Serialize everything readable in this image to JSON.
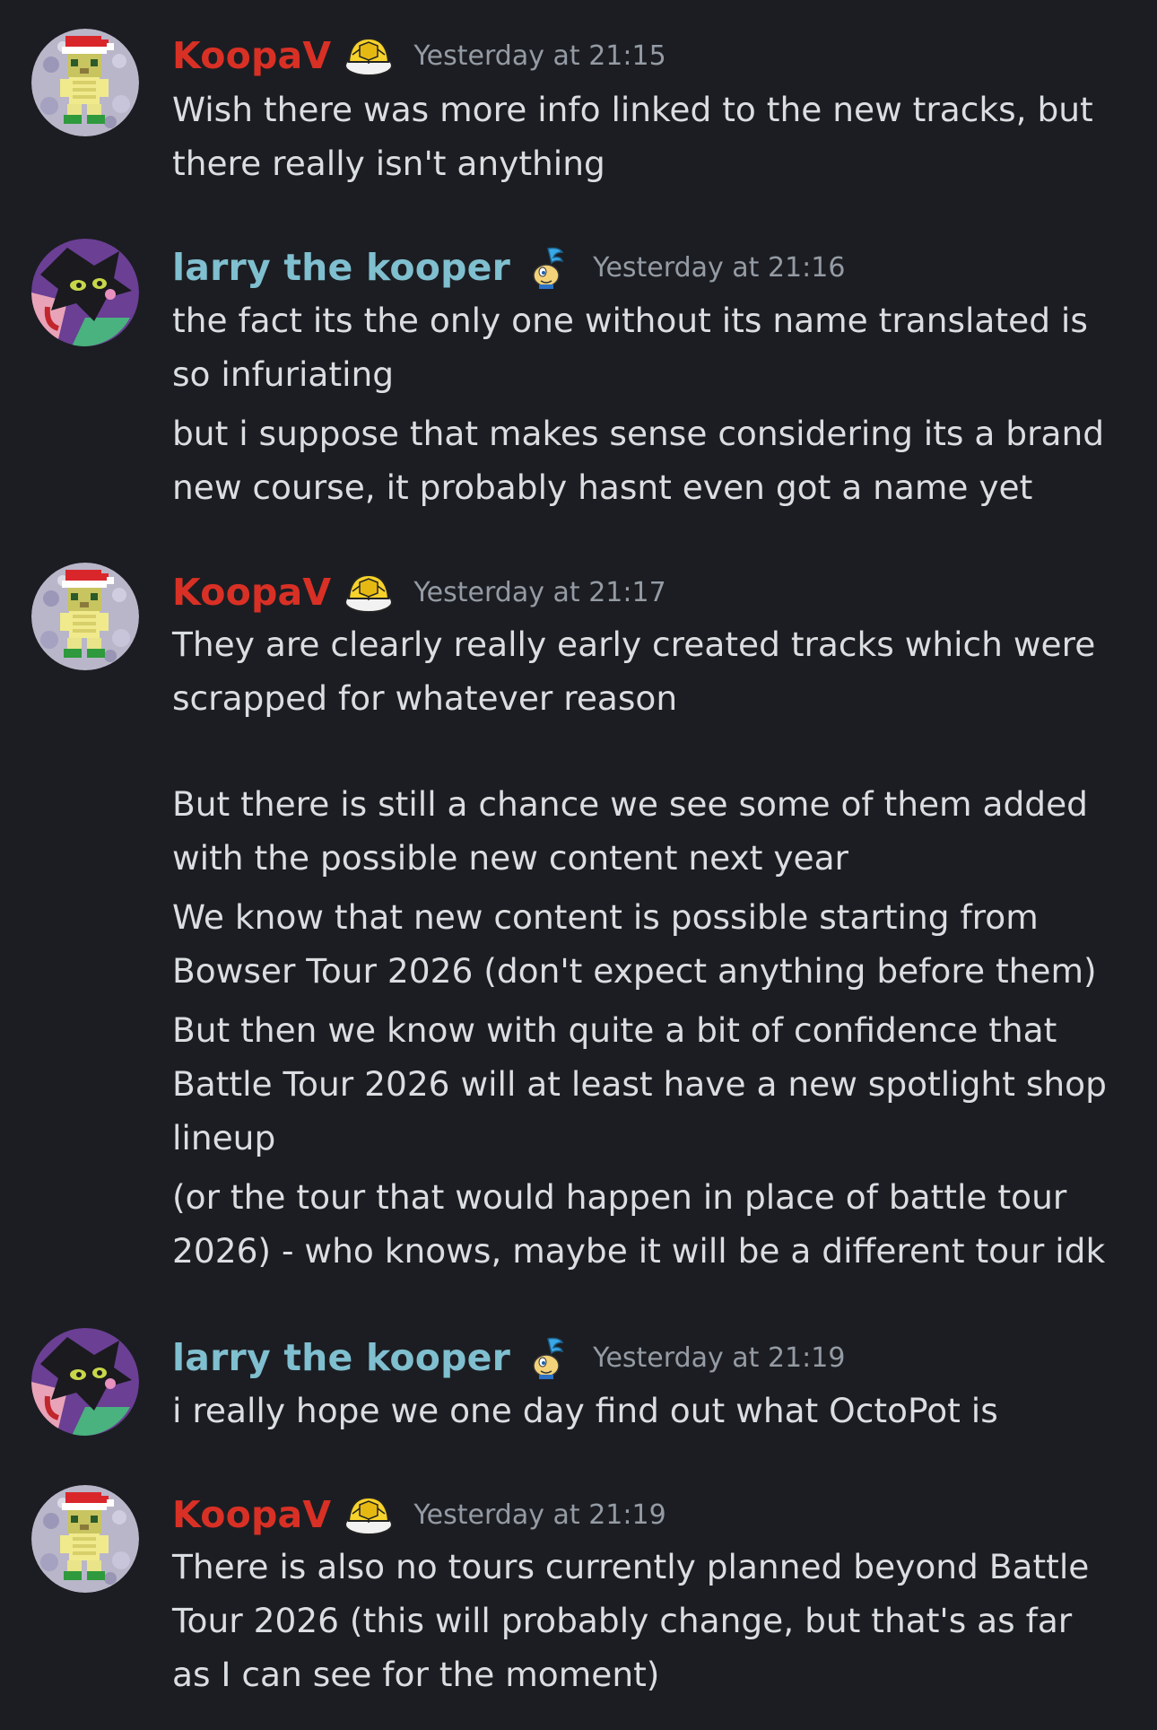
{
  "colors": {
    "background": "#1c1d22",
    "koopa_name": "#d93025",
    "larry_name": "#7fbfcf",
    "timestamp": "#949ba4",
    "text": "#dbdee1"
  },
  "messages": [
    {
      "author": "KoopaV",
      "author_color": "#d93025",
      "avatar_icon": "pixel-koopa-santa-hat-avatar",
      "badge_icon": "yellow-koopa-shell-icon",
      "timestamp": "Yesterday at 21:15",
      "paragraphs": [
        [
          "Wish there was more info linked to the new tracks, but",
          "there really isn't anything"
        ]
      ]
    },
    {
      "author": "larry the kooper",
      "author_color": "#7fbfcf",
      "avatar_icon": "dark-cat-creature-avatar",
      "badge_icon": "larry-koopa-icon",
      "timestamp": "Yesterday at 21:16",
      "paragraphs": [
        [
          "the fact its the only one without its name translated is",
          "so infuriating"
        ],
        [
          "but i suppose that makes sense considering its a brand",
          "new course, it probably hasnt even got a name yet"
        ]
      ]
    },
    {
      "author": "KoopaV",
      "author_color": "#d93025",
      "avatar_icon": "pixel-koopa-santa-hat-avatar",
      "badge_icon": "yellow-koopa-shell-icon",
      "timestamp": "Yesterday at 21:17",
      "paragraphs": [
        [
          "They are clearly really early created tracks which were",
          "scrapped for whatever reason",
          "",
          "But there is still a chance we see some of them added",
          "with the possible new content next year"
        ],
        [
          "We know that new content is possible starting from",
          "Bowser Tour 2026 (don't expect anything before them)"
        ],
        [
          "But then we know with quite a bit of confidence that",
          "Battle Tour 2026 will at least have a new spotlight shop",
          "lineup"
        ],
        [
          "(or the tour that would happen in place of battle tour",
          "2026) - who knows, maybe it will be a different tour idk"
        ]
      ]
    },
    {
      "author": "larry the kooper",
      "author_color": "#7fbfcf",
      "avatar_icon": "dark-cat-creature-avatar",
      "badge_icon": "larry-koopa-icon",
      "timestamp": "Yesterday at 21:19",
      "paragraphs": [
        [
          "i really hope we one day find out what OctoPot is"
        ]
      ]
    },
    {
      "author": "KoopaV",
      "author_color": "#d93025",
      "avatar_icon": "pixel-koopa-santa-hat-avatar",
      "badge_icon": "yellow-koopa-shell-icon",
      "timestamp": "Yesterday at 21:19",
      "paragraphs": [
        [
          "There is also no tours currently planned beyond Battle",
          "Tour 2026 (this will probably change, but that's as far",
          "as I can see for the moment)"
        ]
      ]
    }
  ]
}
